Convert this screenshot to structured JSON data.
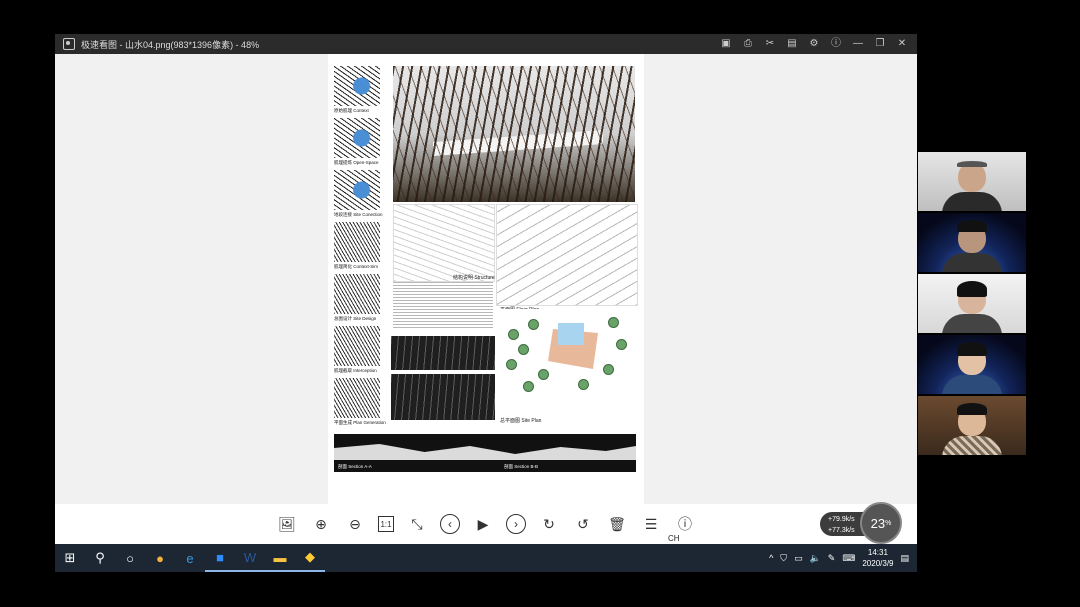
{
  "window": {
    "title": "极速看图 - 山水04.png(983*1396像素) - 48%",
    "buttons": [
      "save-icon",
      "print-icon",
      "crop-icon",
      "comment-icon",
      "settings-icon",
      "info-icon",
      "minimize-icon",
      "restore-icon",
      "close-icon"
    ]
  },
  "sheet": {
    "thumb_labels": [
      "原始肌理 Context",
      "肌理提炼 Open-Space",
      "地段连接 Site Conection",
      "肌理简化 Context-Sim",
      "总图设计 Site Design",
      "肌理截取 Interception",
      "平面生成 Plan Generation"
    ],
    "structure_label": "结构说明 Structure",
    "floor_plan_label": "平面图 Floor Plan",
    "site_plan_label": "总平面图 Site Plan",
    "section_label_a": "剖面 Section A-A",
    "section_label_b": "剖面 Section B-B"
  },
  "toolbar": {
    "tools": [
      "image-icon",
      "zoom-in-icon",
      "zoom-out-icon",
      "actual-size-icon",
      "fit-icon",
      "prev-icon",
      "slideshow-icon",
      "next-icon",
      "rotate-right-icon",
      "rotate-left-icon",
      "delete-icon",
      "menu-icon",
      "info-icon"
    ],
    "actual_size_text": "1:1",
    "ime_label": "CH"
  },
  "net_widget": {
    "upload": "+79.9k/s",
    "download": "+77.3k/s",
    "percent": "23",
    "percent_unit": "%"
  },
  "taskbar": {
    "time": "14:31",
    "date": "2020/3/9"
  },
  "colors": {
    "taskbar": "#1c2733",
    "titlebar": "#2b2b2b",
    "accent": "#8bb7e8"
  }
}
